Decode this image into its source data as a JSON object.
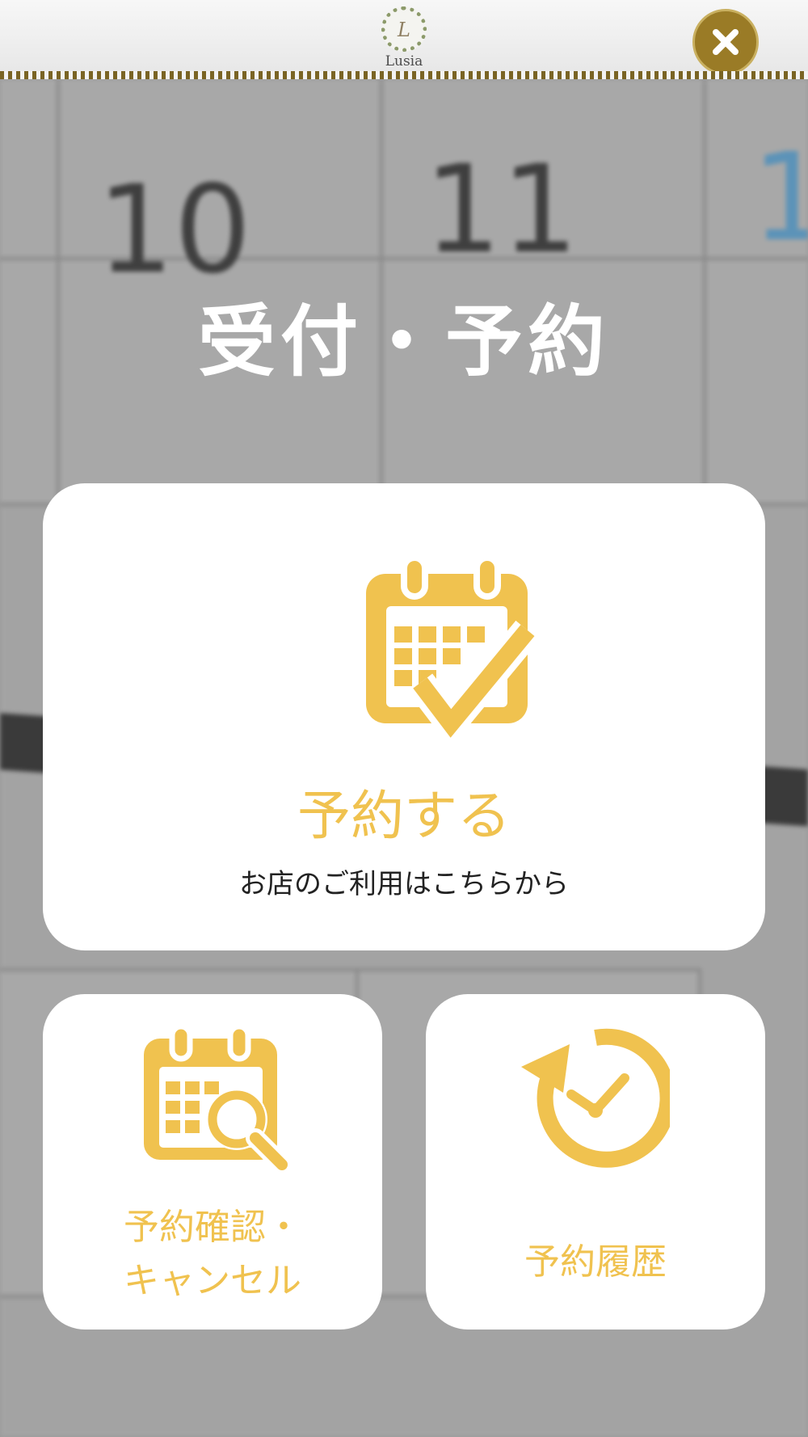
{
  "header": {
    "logo_text": "Lusia",
    "close_icon": "close-icon"
  },
  "page": {
    "title": "受付・予約"
  },
  "cards": {
    "reserve": {
      "label": "予約する",
      "sub": "お店のご利用はこちらから",
      "icon": "calendar-check-icon"
    },
    "confirm": {
      "label_line1": "予約確認・",
      "label_line2": "キャンセル",
      "icon": "calendar-search-icon"
    },
    "history": {
      "label": "予約履歴",
      "icon": "history-clock-icon"
    }
  },
  "colors": {
    "accent": "#f0c24f",
    "close_button": "#9a7b26",
    "card_bg": "#ffffff",
    "overlay": "#9a9a9a"
  }
}
